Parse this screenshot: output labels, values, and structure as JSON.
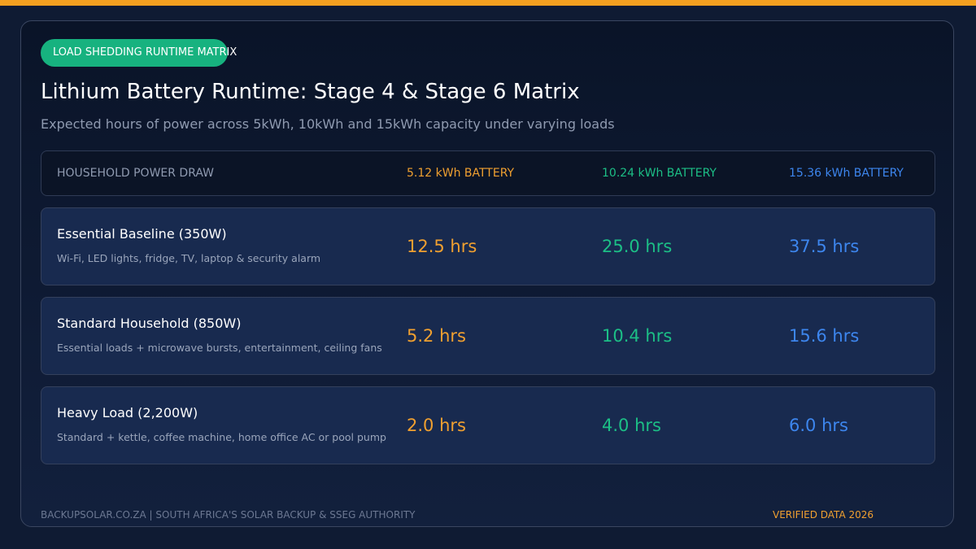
{
  "colors": {
    "accent_top_bar": "#f5a020",
    "badge": "#17b27f",
    "battery_5": "#f0a030",
    "battery_10": "#1cbf86",
    "battery_15": "#3d86ee"
  },
  "badge": {
    "label": "LOAD SHEDDING RUNTIME MATRIX"
  },
  "title": "Lithium Battery Runtime: Stage 4 & Stage 6 Matrix",
  "subtitle": "Expected hours of power across 5kWh, 10kWh and 15kWh capacity under varying loads",
  "table": {
    "headers": [
      "HOUSEHOLD POWER DRAW",
      "5.12 kWh BATTERY",
      "10.24 kWh BATTERY",
      "15.36 kWh BATTERY"
    ],
    "rows": [
      {
        "title": "Essential Baseline (350W)",
        "description": "Wi-Fi, LED lights, fridge, TV, laptop & security alarm",
        "values": [
          "12.5 hrs",
          "25.0 hrs",
          "37.5 hrs"
        ]
      },
      {
        "title": "Standard Household (850W)",
        "description": "Essential loads + microwave bursts, entertainment, ceiling fans",
        "values": [
          "5.2 hrs",
          "10.4 hrs",
          "15.6 hrs"
        ]
      },
      {
        "title": "Heavy Load (2,200W)",
        "description": "Standard + kettle, coffee machine, home office AC or pool pump",
        "values": [
          "2.0 hrs",
          "4.0 hrs",
          "6.0 hrs"
        ]
      }
    ]
  },
  "footer": {
    "left": "BACKUPSOLAR.CO.ZA | SOUTH AFRICA'S SOLAR BACKUP & SSEG AUTHORITY",
    "right": "VERIFIED DATA 2026"
  }
}
